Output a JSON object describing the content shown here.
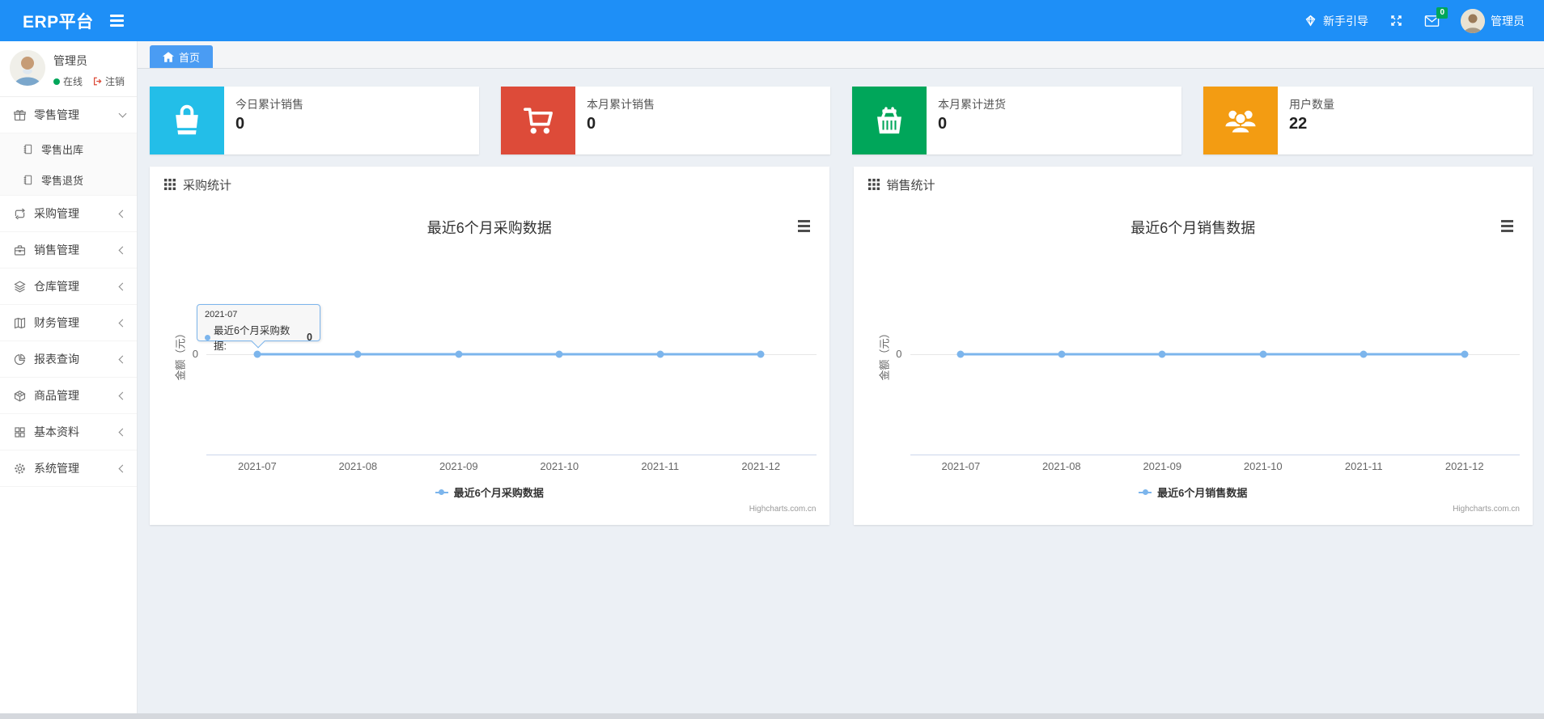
{
  "colors": {
    "navbar_blue": "#1E8FF7",
    "active_tab_blue": "#4A9CF3",
    "card_cyan": "#23BEE8",
    "card_red": "#DD4B39",
    "card_green": "#00A65A",
    "card_orange": "#F39C12",
    "chart_line_blue": "#7CB5EC",
    "badge_green": "#00A65A",
    "online_green": "#00A65A",
    "logout_red": "#DD4B39"
  },
  "navbar": {
    "brand": "ERP平台",
    "guide_label": "新手引导",
    "message_badge": "0",
    "user_name": "管理员",
    "icons": [
      "hamburger-icon",
      "gem-icon",
      "fullscreen-icon",
      "envelope-icon",
      "avatar"
    ]
  },
  "sidebar": {
    "user": {
      "name": "管理员",
      "status": "在线",
      "logout": "注销"
    },
    "menu": [
      {
        "label": "零售管理",
        "icon": "gift-icon",
        "state": "expanded",
        "children": [
          {
            "label": "零售出库",
            "icon": "journal-icon"
          },
          {
            "label": "零售退货",
            "icon": "journal-icon"
          }
        ]
      },
      {
        "label": "采购管理",
        "icon": "repeat-icon",
        "state": "collapsed"
      },
      {
        "label": "销售管理",
        "icon": "briefcase-icon",
        "state": "collapsed"
      },
      {
        "label": "仓库管理",
        "icon": "layers-icon",
        "state": "collapsed"
      },
      {
        "label": "财务管理",
        "icon": "ledger-icon",
        "state": "collapsed"
      },
      {
        "label": "报表查询",
        "icon": "pie-chart-icon",
        "state": "collapsed"
      },
      {
        "label": "商品管理",
        "icon": "box-icon",
        "state": "collapsed"
      },
      {
        "label": "基本资料",
        "icon": "grid-icon",
        "state": "collapsed"
      },
      {
        "label": "系统管理",
        "icon": "gear-icon",
        "state": "collapsed"
      }
    ]
  },
  "tab_bar": {
    "home_label": "首页",
    "home_icon": "home-icon"
  },
  "stat_cards": [
    {
      "label": "今日累计销售",
      "value": "0",
      "icon": "shopping-bag-icon",
      "color": "#23BEE8"
    },
    {
      "label": "本月累计销售",
      "value": "0",
      "icon": "cart-icon",
      "color": "#DD4B39"
    },
    {
      "label": "本月累计进货",
      "value": "0",
      "icon": "basket-icon",
      "color": "#00A65A"
    },
    {
      "label": "用户数量",
      "value": "22",
      "icon": "users-icon",
      "color": "#F39C12"
    }
  ],
  "panels": [
    {
      "header": "采购统计",
      "header_icon": "th-grid-icon"
    },
    {
      "header": "销售统计",
      "header_icon": "th-grid-icon"
    }
  ],
  "chart_data": [
    {
      "type": "line",
      "title": "最近6个月采购数据",
      "x": [
        "2021-07",
        "2021-08",
        "2021-09",
        "2021-10",
        "2021-11",
        "2021-12"
      ],
      "series": [
        {
          "name": "最近6个月采购数据",
          "values": [
            0,
            0,
            0,
            0,
            0,
            0
          ]
        }
      ],
      "ylabel": "金额（元）",
      "ytick_labels": [
        "0"
      ],
      "grid": "zero-line-only",
      "legend_position": "bottom",
      "line_color": "#7CB5EC",
      "credits": "Highcharts.com.cn",
      "tooltip": {
        "visible": true,
        "title": "2021-07",
        "series_label": "最近6个月采购数据:",
        "value": "0"
      }
    },
    {
      "type": "line",
      "title": "最近6个月销售数据",
      "x": [
        "2021-07",
        "2021-08",
        "2021-09",
        "2021-10",
        "2021-11",
        "2021-12"
      ],
      "series": [
        {
          "name": "最近6个月销售数据",
          "values": [
            0,
            0,
            0,
            0,
            0,
            0
          ]
        }
      ],
      "ylabel": "金额（元）",
      "ytick_labels": [
        "0"
      ],
      "grid": "zero-line-only",
      "legend_position": "bottom",
      "line_color": "#7CB5EC",
      "credits": "Highcharts.com.cn",
      "tooltip": {
        "visible": false
      }
    }
  ]
}
